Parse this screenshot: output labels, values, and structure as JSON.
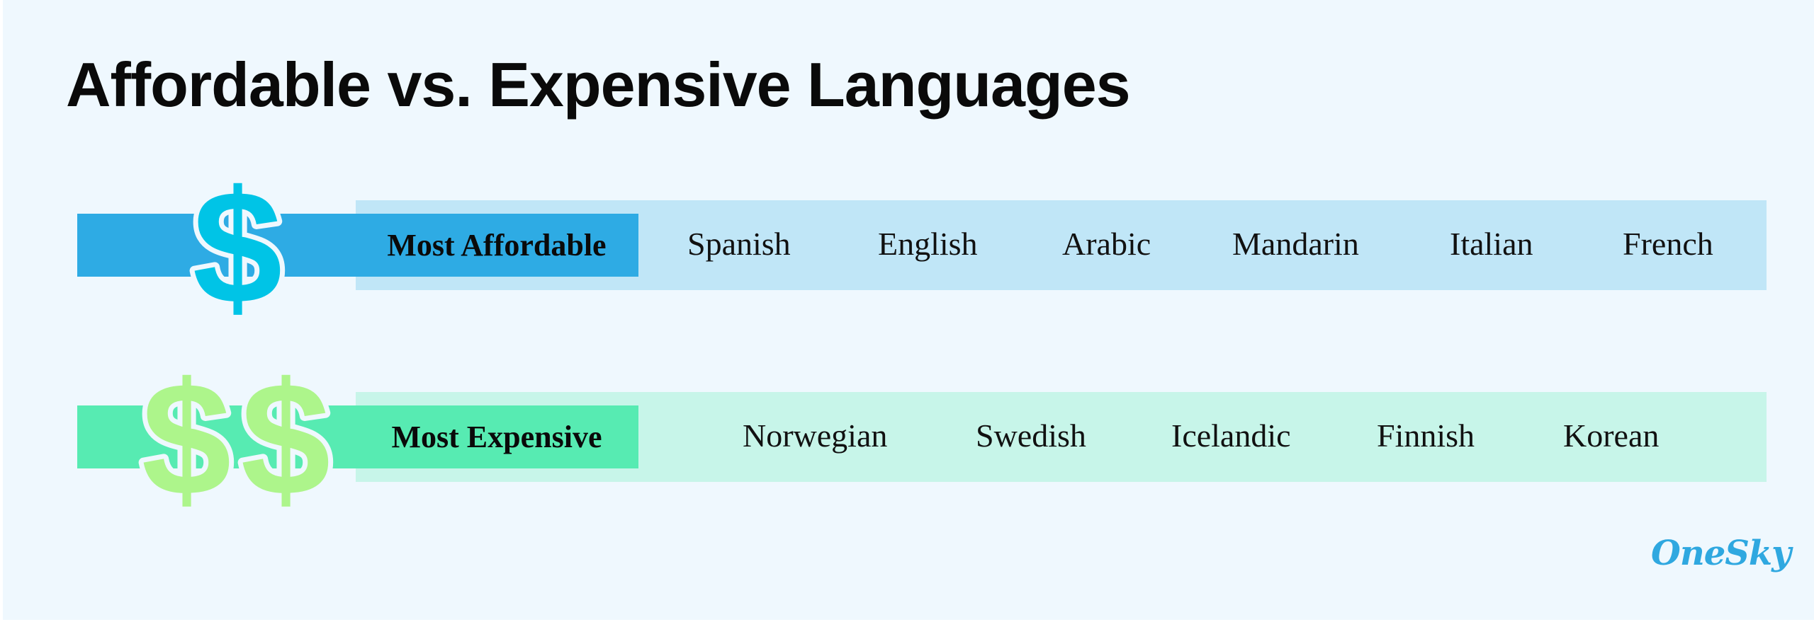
{
  "title": "Affordable vs. Expensive Languages",
  "colors": {
    "background": "#EFF8FE",
    "affordable_dark": "#2EABE4",
    "affordable_light": "#C0E6F7",
    "affordable_dollar": "#00C4E6",
    "expensive_dark": "#57EBB2",
    "expensive_light": "#C7F5E9",
    "expensive_dollar": "#ADF58B",
    "logo": "#2FA8E0"
  },
  "rows": [
    {
      "label": "Most Affordable",
      "icon": "single-dollar-icon",
      "dollar_symbol": "$",
      "languages": [
        "Spanish",
        "English",
        "Arabic",
        "Mandarin",
        "Italian",
        "French"
      ]
    },
    {
      "label": "Most Expensive",
      "icon": "double-dollar-icon",
      "dollar_symbol": "$",
      "languages": [
        "Norwegian",
        "Swedish",
        "Icelandic",
        "Finnish",
        "Korean"
      ]
    }
  ],
  "logo": {
    "text": "OneSky"
  }
}
